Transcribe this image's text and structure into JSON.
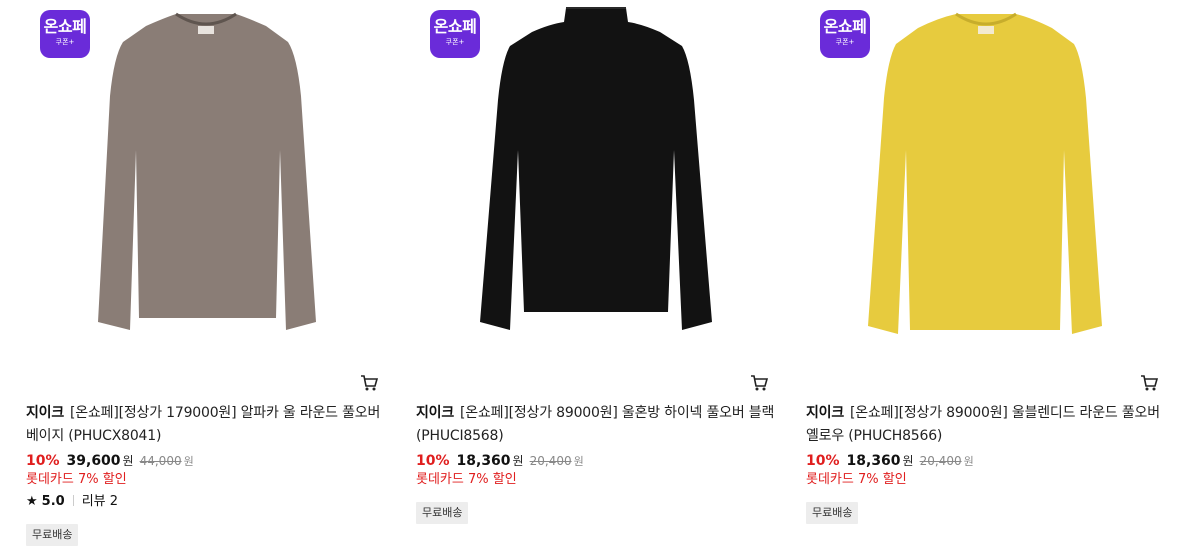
{
  "badge": {
    "title": "온쇼페",
    "sub": "쿠폰+",
    "color": "#6a2bd9"
  },
  "colors": {
    "discount": "#e01e1e",
    "card_promo": "#e01e1e"
  },
  "products": [
    {
      "brand": "지이크",
      "name": "[온쇼페][정상가 179000원] 알파카 울 라운드 풀오버 베이지 (PHUCX8041)",
      "discount": "10%",
      "price": "39,600",
      "price_unit": "원",
      "original_price": "44,000",
      "original_unit": "원",
      "card_promo": "롯데카드 7% 할인",
      "rating": "5.0",
      "review_label": "리뷰 2",
      "tag": "무료배송",
      "garment_color": "#8a7d76",
      "icon": "cart-icon"
    },
    {
      "brand": "지이크",
      "name": "[온쇼페][정상가 89000원] 울혼방 하이넥 풀오버 블랙 (PHUCI8568)",
      "discount": "10%",
      "price": "18,360",
      "price_unit": "원",
      "original_price": "20,400",
      "original_unit": "원",
      "card_promo": "롯데카드 7% 할인",
      "tag": "무료배송",
      "garment_color": "#121212",
      "icon": "cart-icon"
    },
    {
      "brand": "지이크",
      "name": "[온쇼페][정상가 89000원] 울블렌디드 라운드 풀오버 옐로우 (PHUCH8566)",
      "discount": "10%",
      "price": "18,360",
      "price_unit": "원",
      "original_price": "20,400",
      "original_unit": "원",
      "card_promo": "롯데카드 7% 할인",
      "tag": "무료배송",
      "garment_color": "#e7cb3e",
      "icon": "cart-icon"
    }
  ]
}
